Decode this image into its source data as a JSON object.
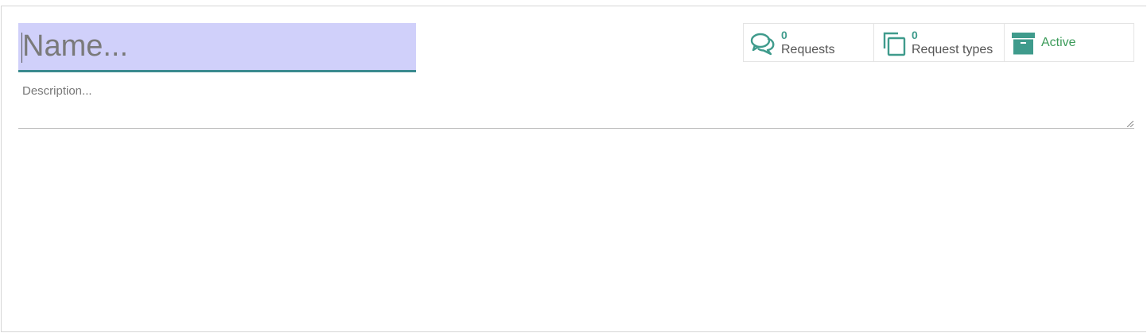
{
  "form": {
    "name_placeholder": "Name...",
    "description_placeholder": "Description..."
  },
  "stat_buttons": {
    "requests": {
      "count": "0",
      "label": "Requests",
      "icon": "comments-icon"
    },
    "request_types": {
      "count": "0",
      "label": "Request types",
      "icon": "copy-icon"
    },
    "archive": {
      "label": "Active",
      "icon": "archive-icon"
    }
  },
  "colors": {
    "accent": "#3f9b8c",
    "active_green": "#3c9b5a",
    "name_highlight": "#d0d0fa",
    "name_underline": "#3a8a8f"
  }
}
